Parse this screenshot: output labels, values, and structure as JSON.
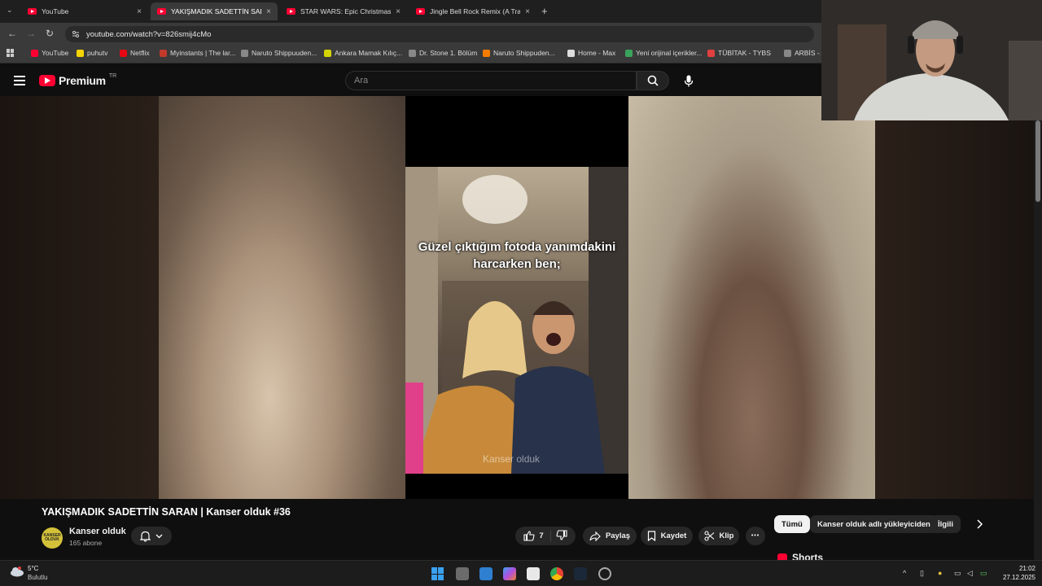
{
  "browser": {
    "tabs": [
      {
        "title": "YouTube",
        "active": false
      },
      {
        "title": "YAKIŞMADIK SADETTİN SARAN",
        "active": true
      },
      {
        "title": "STAR WARS: Epic Christmas Mu",
        "active": false
      },
      {
        "title": "Jingle Bell Rock Remix (A Trapp",
        "active": false
      }
    ],
    "new_tab": "+",
    "close_glyph": "×",
    "url": "youtube.com/watch?v=826smij4cMo",
    "bookmarks": [
      {
        "label": "YouTube",
        "color": "#ff0033"
      },
      {
        "label": "puhutv",
        "color": "#f5d400"
      },
      {
        "label": "Netflix",
        "color": "#e50914"
      },
      {
        "label": "Myinstants | The lar...",
        "color": "#c0392b"
      },
      {
        "label": "Naruto Shippuuden...",
        "color": "#888888"
      },
      {
        "label": "Ankara Mamak Kılıç...",
        "color": "#d4d400"
      },
      {
        "label": "Dr. Stone 1. Bölüm",
        "color": "#888888"
      },
      {
        "label": "Naruto Shippuden...",
        "color": "#f57c00"
      },
      {
        "label": "Home - Max",
        "color": "#dddddd"
      },
      {
        "label": "Yeni orijinal içerikler...",
        "color": "#3aa35b"
      },
      {
        "label": "TÜBİTAK - TYBS",
        "color": "#e04040"
      },
      {
        "label": "ARBİS - Araştı",
        "color": "#888888"
      }
    ]
  },
  "youtube": {
    "logo_text": "Premium",
    "logo_sup": "TR",
    "search_placeholder": "Ara",
    "video": {
      "caption": "Güzel çıktığım fotoda yanımdakini harcarken ben;",
      "watermark": "Kanser olduk"
    },
    "title": "YAKIŞMADIK SADETTİN SARAN | Kanser olduk #36",
    "channel": {
      "name": "Kanser olduk",
      "subscribers": "165 abone",
      "avatar_text": "KANSER OLDUK"
    },
    "actions": {
      "likes": "7",
      "share": "Paylaş",
      "save": "Kaydet",
      "clip": "Klip",
      "more": "•••"
    },
    "chips": [
      {
        "label": "Tümü",
        "active": true
      },
      {
        "label": "Kanser olduk adlı yükleyiciden",
        "active": false
      },
      {
        "label": "İlgili",
        "active": false
      }
    ],
    "shorts_label": "Shorts"
  },
  "taskbar": {
    "weather_temp": "5°C",
    "weather_desc": "Bulutlu",
    "time": "21:02",
    "date": "27.12.2025"
  },
  "colors": {
    "youtube_red": "#ff0033",
    "background": "#0f0f0f",
    "pill_bg": "#272727"
  }
}
